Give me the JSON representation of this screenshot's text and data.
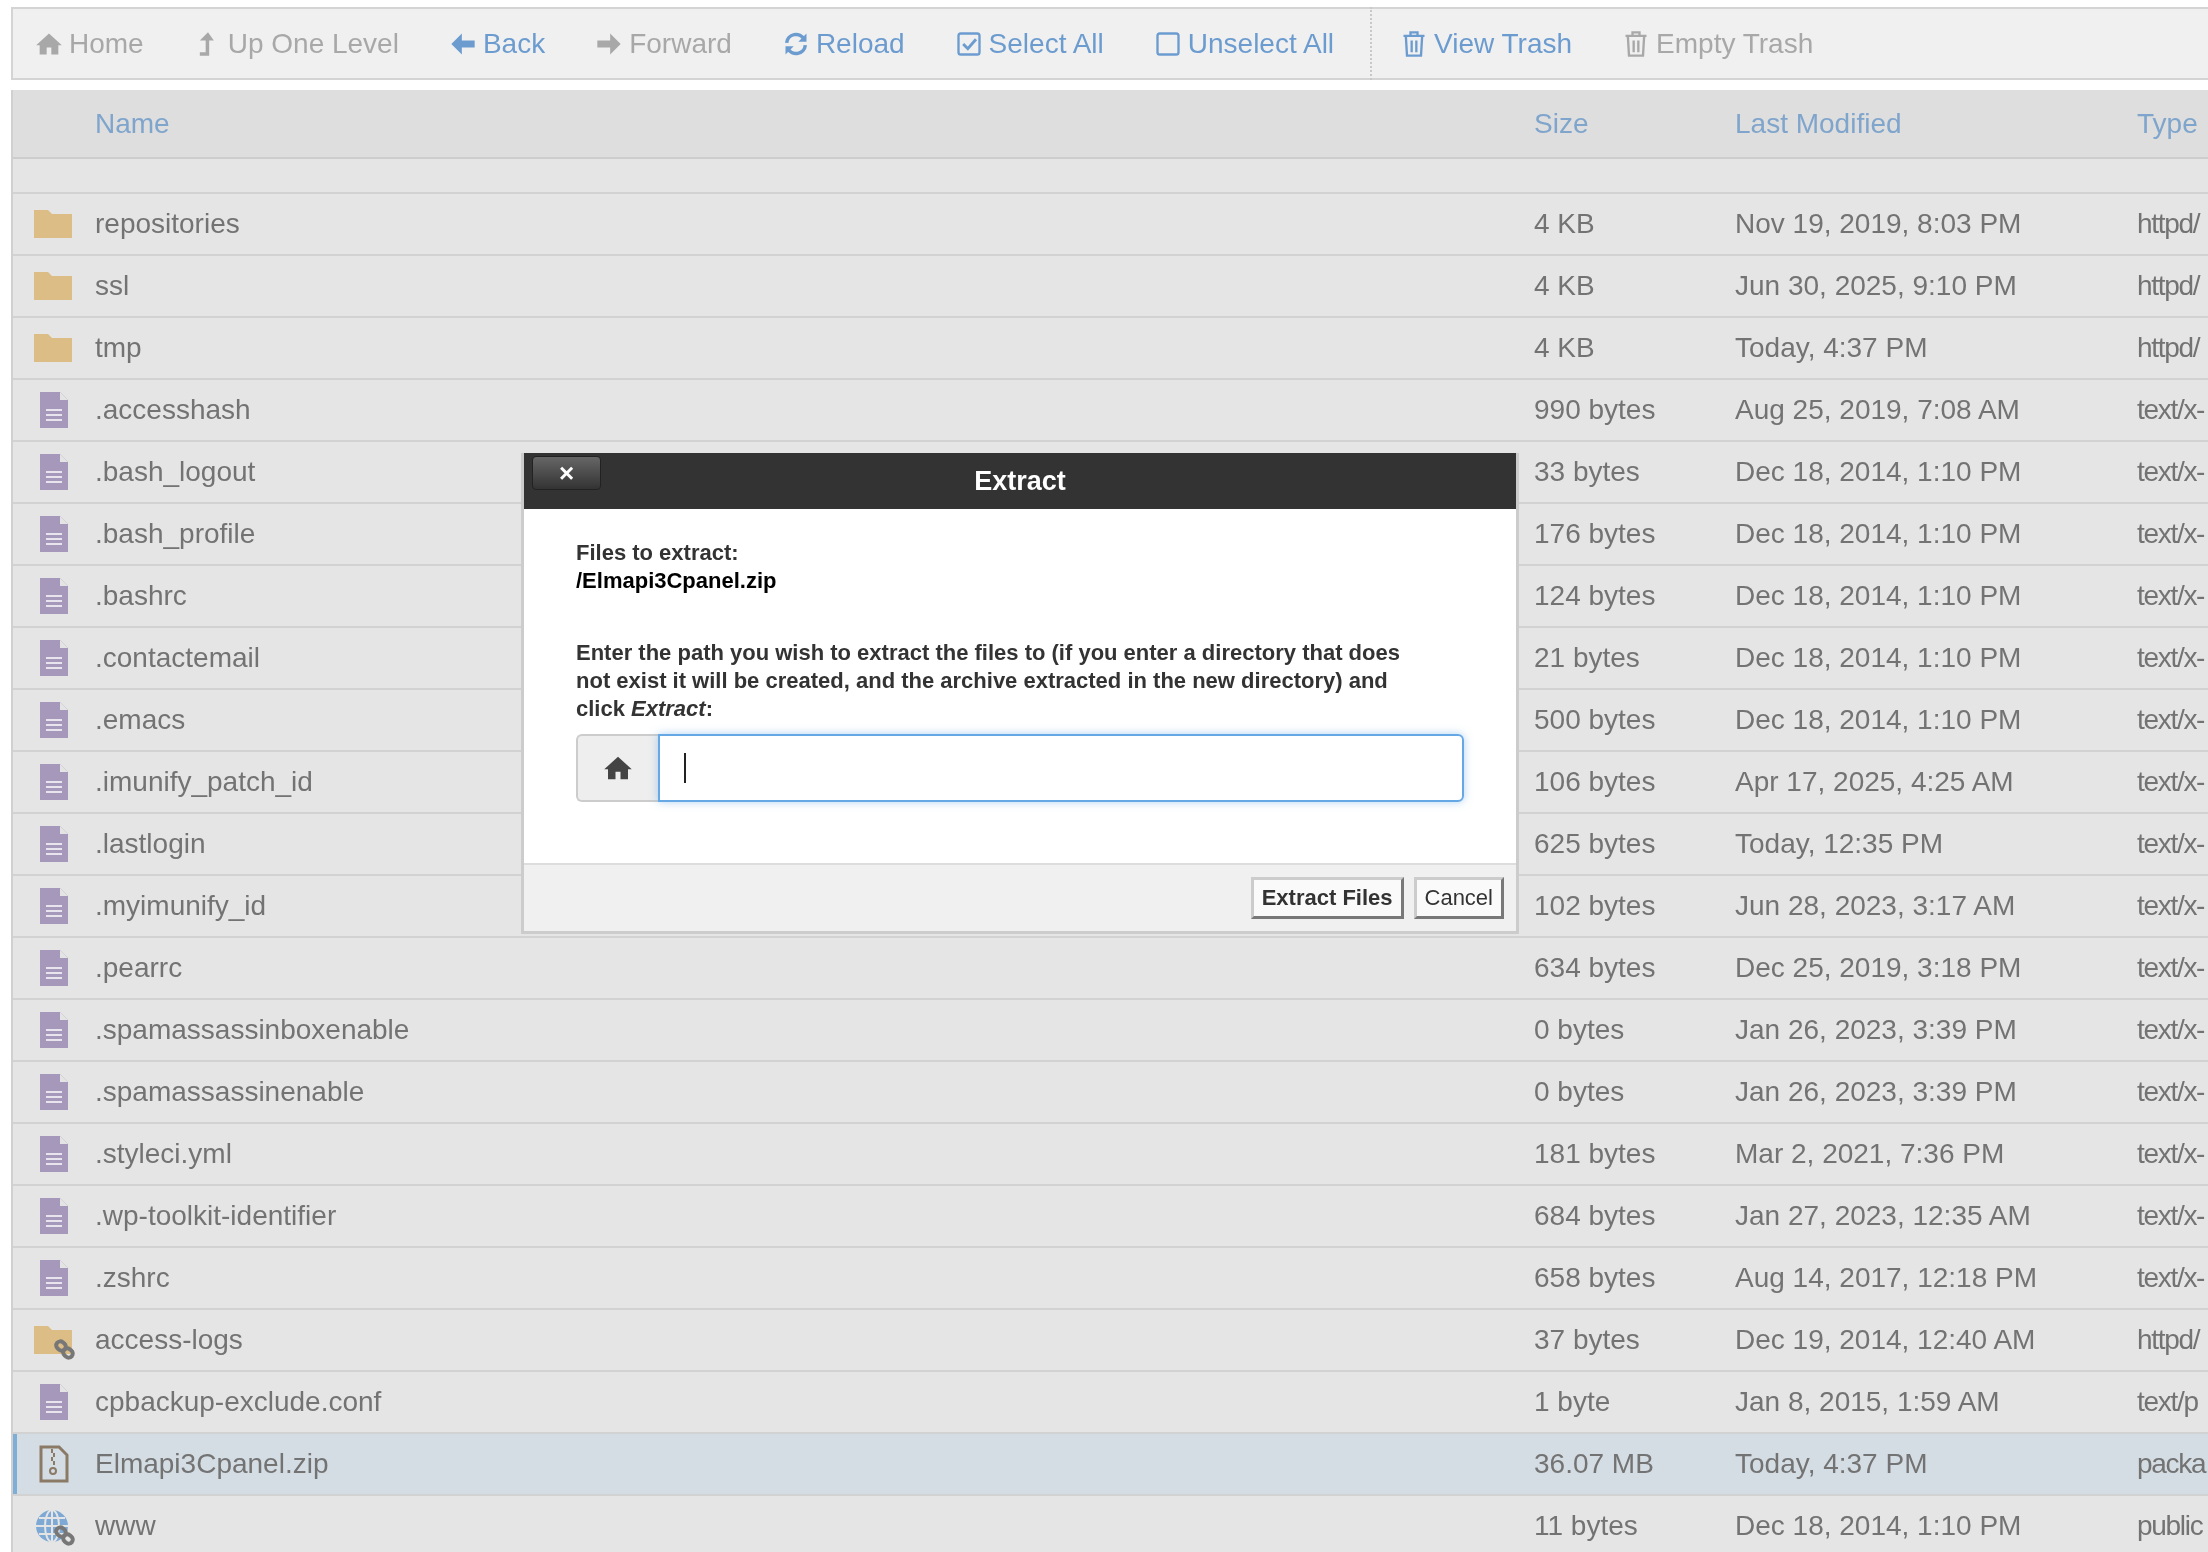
{
  "toolbar": {
    "groups": [
      [
        {
          "kind": "home",
          "label": "Home",
          "disabled": true
        },
        {
          "kind": "up",
          "label": "Up One Level",
          "disabled": true
        },
        {
          "kind": "back",
          "label": "Back",
          "disabled": false
        },
        {
          "kind": "forward",
          "label": "Forward",
          "disabled": true
        },
        {
          "kind": "reload",
          "label": "Reload",
          "disabled": false
        },
        {
          "kind": "check",
          "label": "Select All",
          "disabled": false
        },
        {
          "kind": "box",
          "label": "Unselect All",
          "disabled": false
        }
      ],
      [
        {
          "kind": "trash",
          "label": "View Trash",
          "disabled": false
        },
        {
          "kind": "trash",
          "label": "Empty Trash",
          "disabled": true
        }
      ]
    ]
  },
  "table": {
    "columns": [
      "Name",
      "Size",
      "Last Modified",
      "Type"
    ],
    "rows": [
      {
        "kind": "folder",
        "name": "repositories",
        "size": "4 KB",
        "modified": "Nov 19, 2019, 8:03 PM",
        "type": "httpd/",
        "selected": false
      },
      {
        "kind": "folder",
        "name": "ssl",
        "size": "4 KB",
        "modified": "Jun 30, 2025, 9:10 PM",
        "type": "httpd/",
        "selected": false
      },
      {
        "kind": "folder",
        "name": "tmp",
        "size": "4 KB",
        "modified": "Today, 4:37 PM",
        "type": "httpd/",
        "selected": false
      },
      {
        "kind": "file",
        "name": ".accesshash",
        "size": "990 bytes",
        "modified": "Aug 25, 2019, 7:08 AM",
        "type": "text/x-",
        "selected": false
      },
      {
        "kind": "file",
        "name": ".bash_logout",
        "size": "33 bytes",
        "modified": "Dec 18, 2014, 1:10 PM",
        "type": "text/x-",
        "selected": false
      },
      {
        "kind": "file",
        "name": ".bash_profile",
        "size": "176 bytes",
        "modified": "Dec 18, 2014, 1:10 PM",
        "type": "text/x-",
        "selected": false
      },
      {
        "kind": "file",
        "name": ".bashrc",
        "size": "124 bytes",
        "modified": "Dec 18, 2014, 1:10 PM",
        "type": "text/x-",
        "selected": false
      },
      {
        "kind": "file",
        "name": ".contactemail",
        "size": "21 bytes",
        "modified": "Dec 18, 2014, 1:10 PM",
        "type": "text/x-",
        "selected": false
      },
      {
        "kind": "file",
        "name": ".emacs",
        "size": "500 bytes",
        "modified": "Dec 18, 2014, 1:10 PM",
        "type": "text/x-",
        "selected": false
      },
      {
        "kind": "file",
        "name": ".imunify_patch_id",
        "size": "106 bytes",
        "modified": "Apr 17, 2025, 4:25 AM",
        "type": "text/x-",
        "selected": false
      },
      {
        "kind": "file",
        "name": ".lastlogin",
        "size": "625 bytes",
        "modified": "Today, 12:35 PM",
        "type": "text/x-",
        "selected": false
      },
      {
        "kind": "file",
        "name": ".myimunify_id",
        "size": "102 bytes",
        "modified": "Jun 28, 2023, 3:17 AM",
        "type": "text/x-",
        "selected": false
      },
      {
        "kind": "file",
        "name": ".pearrc",
        "size": "634 bytes",
        "modified": "Dec 25, 2019, 3:18 PM",
        "type": "text/x-",
        "selected": false
      },
      {
        "kind": "file",
        "name": ".spamassassinboxenable",
        "size": "0 bytes",
        "modified": "Jan 26, 2023, 3:39 PM",
        "type": "text/x-",
        "selected": false
      },
      {
        "kind": "file",
        "name": ".spamassassinenable",
        "size": "0 bytes",
        "modified": "Jan 26, 2023, 3:39 PM",
        "type": "text/x-",
        "selected": false
      },
      {
        "kind": "file",
        "name": ".styleci.yml",
        "size": "181 bytes",
        "modified": "Mar 2, 2021, 7:36 PM",
        "type": "text/x-",
        "selected": false
      },
      {
        "kind": "file",
        "name": ".wp-toolkit-identifier",
        "size": "684 bytes",
        "modified": "Jan 27, 2023, 12:35 AM",
        "type": "text/x-",
        "selected": false
      },
      {
        "kind": "file",
        "name": ".zshrc",
        "size": "658 bytes",
        "modified": "Aug 14, 2017, 12:18 PM",
        "type": "text/x-",
        "selected": false
      },
      {
        "kind": "folder-link",
        "name": "access-logs",
        "size": "37 bytes",
        "modified": "Dec 19, 2014, 12:40 AM",
        "type": "httpd/",
        "selected": false
      },
      {
        "kind": "file",
        "name": "cpbackup-exclude.conf",
        "size": "1 byte",
        "modified": "Jan 8, 2015, 1:59 AM",
        "type": "text/p",
        "selected": false
      },
      {
        "kind": "zip",
        "name": "Elmapi3Cpanel.zip",
        "size": "36.07 MB",
        "modified": "Today, 4:37 PM",
        "type": "packa",
        "selected": true
      },
      {
        "kind": "globe-link",
        "name": "www",
        "size": "11 bytes",
        "modified": "Dec 18, 2014, 1:10 PM",
        "type": "public",
        "selected": false
      }
    ]
  },
  "dialog": {
    "title": "Extract",
    "close": "×",
    "files_label": "Files to extract:",
    "file": "/Elmapi3Cpanel.zip",
    "instruction": "Enter the path you wish to extract the files to (if you enter a directory that does not exist it will be created, and the archive extracted in the new directory) and click *Extract*:",
    "buttons": [
      "Extract Files",
      "Cancel"
    ]
  }
}
